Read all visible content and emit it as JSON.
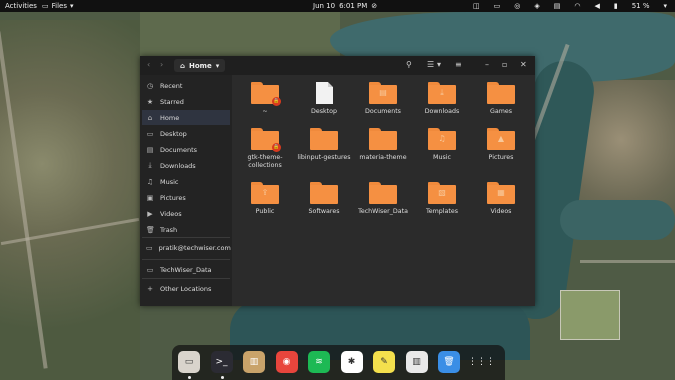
{
  "topbar": {
    "activities": "Activities",
    "files_menu": "Files",
    "date": "Jun 10",
    "time": "6:01 PM",
    "battery": "51 %"
  },
  "window": {
    "path": "Home"
  },
  "sidebar": {
    "items": [
      {
        "label": "Recent",
        "icon": "clock-icon",
        "glyph": "◷"
      },
      {
        "label": "Starred",
        "icon": "star-icon",
        "glyph": "★"
      },
      {
        "label": "Home",
        "icon": "home-icon",
        "glyph": "⌂"
      },
      {
        "label": "Desktop",
        "icon": "desktop-icon",
        "glyph": "▭"
      },
      {
        "label": "Documents",
        "icon": "documents-icon",
        "glyph": "▤"
      },
      {
        "label": "Downloads",
        "icon": "download-icon",
        "glyph": "⤓"
      },
      {
        "label": "Music",
        "icon": "music-icon",
        "glyph": "♫"
      },
      {
        "label": "Pictures",
        "icon": "pictures-icon",
        "glyph": "▣"
      },
      {
        "label": "Videos",
        "icon": "videos-icon",
        "glyph": "▶"
      },
      {
        "label": "Trash",
        "icon": "trash-icon",
        "glyph": "🗑"
      },
      {
        "label": "pratik@techwiser.com",
        "icon": "network-drive-icon",
        "glyph": "▭"
      },
      {
        "label": "TechWiser_Data",
        "icon": "drive-icon",
        "glyph": "▭"
      },
      {
        "label": "Other Locations",
        "icon": "plus-icon",
        "glyph": "+"
      }
    ]
  },
  "files": [
    {
      "name": "~",
      "kind": "folder-locked"
    },
    {
      "name": "Desktop",
      "kind": "document"
    },
    {
      "name": "Documents",
      "kind": "folder",
      "glyph": "▤"
    },
    {
      "name": "Downloads",
      "kind": "folder",
      "glyph": "⤓"
    },
    {
      "name": "Games",
      "kind": "folder",
      "glyph": ""
    },
    {
      "name": "gtk-theme-collections",
      "kind": "folder-locked"
    },
    {
      "name": "libinput-gestures",
      "kind": "folder",
      "glyph": ""
    },
    {
      "name": "materia-theme",
      "kind": "folder",
      "glyph": ""
    },
    {
      "name": "Music",
      "kind": "folder",
      "glyph": "♫"
    },
    {
      "name": "Pictures",
      "kind": "folder",
      "glyph": "▲"
    },
    {
      "name": "Public",
      "kind": "folder",
      "glyph": "⇪"
    },
    {
      "name": "Softwares",
      "kind": "folder",
      "glyph": ""
    },
    {
      "name": "TechWiser_Data",
      "kind": "folder",
      "glyph": ""
    },
    {
      "name": "Templates",
      "kind": "folder",
      "glyph": "▧"
    },
    {
      "name": "Videos",
      "kind": "folder",
      "glyph": "▦"
    }
  ],
  "dock": [
    {
      "name": "files-app-icon",
      "color": "#d9d4cc",
      "glyph": "▭"
    },
    {
      "name": "terminal-icon",
      "color": "#2b2b33",
      "glyph": ">_"
    },
    {
      "name": "archive-manager-icon",
      "color": "#c9a36a",
      "glyph": "▥"
    },
    {
      "name": "chrome-icon",
      "color": "#e8453c",
      "glyph": "◉"
    },
    {
      "name": "spotify-icon",
      "color": "#1db954",
      "glyph": "≋"
    },
    {
      "name": "slack-icon",
      "color": "#ffffff",
      "glyph": "✱"
    },
    {
      "name": "notes-icon",
      "color": "#f4e04d",
      "glyph": "✎"
    },
    {
      "name": "system-monitor-icon",
      "color": "#e9e9e9",
      "glyph": "▥"
    },
    {
      "name": "trash-dock-icon",
      "color": "#3a8ee6",
      "glyph": "🗑"
    },
    {
      "name": "app-grid-icon",
      "color": "transparent",
      "glyph": "⋮⋮⋮"
    }
  ],
  "colors": {
    "folder": "#f59042",
    "window_bg": "#2b2b2b",
    "sidebar_bg": "#232323",
    "selected": "#2f3440"
  }
}
